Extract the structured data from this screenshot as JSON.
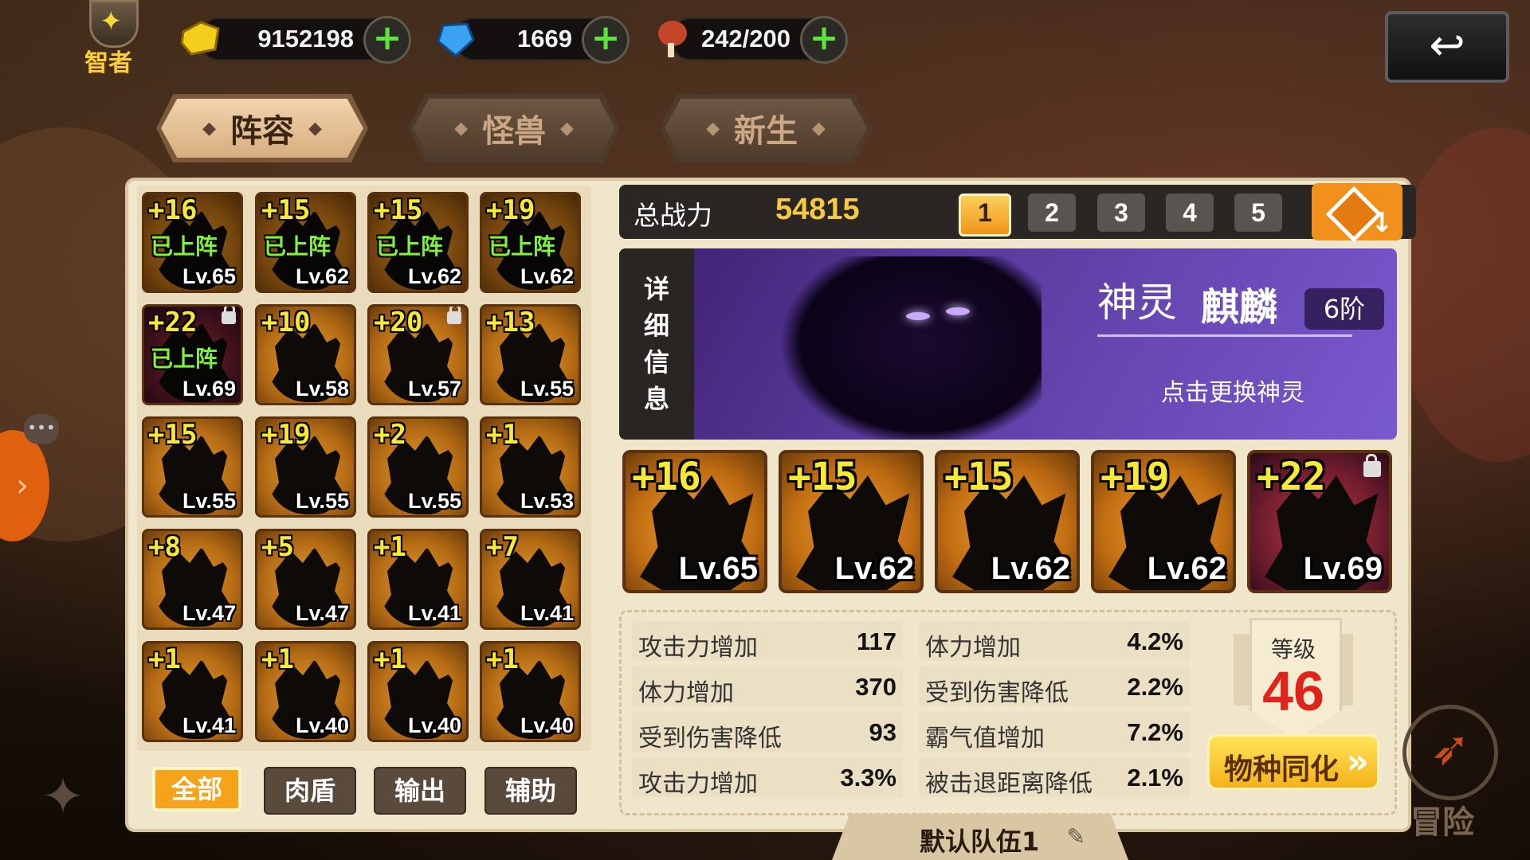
{
  "topbar": {
    "hint_label": "智者",
    "gold": "9152198",
    "gems": "1669",
    "stamina": "242/200",
    "plus": "+",
    "back_icon": "↩"
  },
  "tabs": [
    {
      "label": "阵容",
      "active": true
    },
    {
      "label": "怪兽",
      "active": false
    },
    {
      "label": "新生",
      "active": false
    }
  ],
  "roster": [
    {
      "plus": "+16",
      "lv": "Lv.65",
      "deployed": "已上阵",
      "red": false,
      "locked": false
    },
    {
      "plus": "+15",
      "lv": "Lv.62",
      "deployed": "已上阵",
      "red": false,
      "locked": false
    },
    {
      "plus": "+15",
      "lv": "Lv.62",
      "deployed": "已上阵",
      "red": false,
      "locked": false
    },
    {
      "plus": "+19",
      "lv": "Lv.62",
      "deployed": "已上阵",
      "red": false,
      "locked": false
    },
    {
      "plus": "+22",
      "lv": "Lv.69",
      "deployed": "已上阵",
      "red": true,
      "locked": true
    },
    {
      "plus": "+10",
      "lv": "Lv.58",
      "deployed": "",
      "red": false,
      "locked": false
    },
    {
      "plus": "+20",
      "lv": "Lv.57",
      "deployed": "",
      "red": false,
      "locked": true
    },
    {
      "plus": "+13",
      "lv": "Lv.55",
      "deployed": "",
      "red": false,
      "locked": false
    },
    {
      "plus": "+15",
      "lv": "Lv.55",
      "deployed": "",
      "red": false,
      "locked": false
    },
    {
      "plus": "+19",
      "lv": "Lv.55",
      "deployed": "",
      "red": false,
      "locked": false
    },
    {
      "plus": "+2",
      "lv": "Lv.55",
      "deployed": "",
      "red": false,
      "locked": false
    },
    {
      "plus": "+1",
      "lv": "Lv.53",
      "deployed": "",
      "red": false,
      "locked": false
    },
    {
      "plus": "+8",
      "lv": "Lv.47",
      "deployed": "",
      "red": false,
      "locked": false
    },
    {
      "plus": "+5",
      "lv": "Lv.47",
      "deployed": "",
      "red": false,
      "locked": false
    },
    {
      "plus": "+1",
      "lv": "Lv.41",
      "deployed": "",
      "red": false,
      "locked": false
    },
    {
      "plus": "+7",
      "lv": "Lv.41",
      "deployed": "",
      "red": false,
      "locked": false
    },
    {
      "plus": "+1",
      "lv": "Lv.41",
      "deployed": "",
      "red": false,
      "locked": false
    },
    {
      "plus": "+1",
      "lv": "Lv.40",
      "deployed": "",
      "red": false,
      "locked": false
    },
    {
      "plus": "+1",
      "lv": "Lv.40",
      "deployed": "",
      "red": false,
      "locked": false
    },
    {
      "plus": "+1",
      "lv": "Lv.40",
      "deployed": "",
      "red": false,
      "locked": false
    }
  ],
  "filters": [
    {
      "label": "全部",
      "active": true
    },
    {
      "label": "肉盾",
      "active": false
    },
    {
      "label": "输出",
      "active": false
    },
    {
      "label": "辅助",
      "active": false
    }
  ],
  "power": {
    "label": "总战力",
    "value": "54815"
  },
  "team_slots": [
    {
      "label": "1",
      "active": true
    },
    {
      "label": "2",
      "active": false
    },
    {
      "label": "3",
      "active": false
    },
    {
      "label": "4",
      "active": false
    },
    {
      "label": "5",
      "active": false
    }
  ],
  "guardian": {
    "detail_chars": [
      "详",
      "细",
      "信",
      "息"
    ],
    "name_a": "神灵",
    "name_b": "麒麟",
    "rank": "6阶",
    "tap_hint": "点击更换神灵"
  },
  "team": [
    {
      "plus": "+16",
      "lv": "Lv.65",
      "red": false,
      "locked": false
    },
    {
      "plus": "+15",
      "lv": "Lv.62",
      "red": false,
      "locked": false
    },
    {
      "plus": "+15",
      "lv": "Lv.62",
      "red": false,
      "locked": false
    },
    {
      "plus": "+19",
      "lv": "Lv.62",
      "red": false,
      "locked": false
    },
    {
      "plus": "+22",
      "lv": "Lv.69",
      "red": true,
      "locked": true
    }
  ],
  "stats_left": [
    {
      "k": "攻击力增加",
      "v": "117"
    },
    {
      "k": "体力增加",
      "v": "370"
    },
    {
      "k": "受到伤害降低",
      "v": "93"
    },
    {
      "k": "攻击力增加",
      "v": "3.3%"
    }
  ],
  "stats_right": [
    {
      "k": "体力增加",
      "v": "4.2%"
    },
    {
      "k": "受到伤害降低",
      "v": "2.2%"
    },
    {
      "k": "霸气值增加",
      "v": "7.2%"
    },
    {
      "k": "被击退距离降低",
      "v": "2.1%"
    }
  ],
  "level": {
    "label": "等级",
    "value": "46"
  },
  "evolve": {
    "label": "物种同化",
    "arrows": "»"
  },
  "team_name": "默认队伍1",
  "edit_icon": "✎",
  "adventure": "冒险",
  "colors": {
    "accent": "#f7a21b",
    "deployed": "#7ff23a",
    "plus": "#f7e935",
    "level": "#e0241c"
  }
}
